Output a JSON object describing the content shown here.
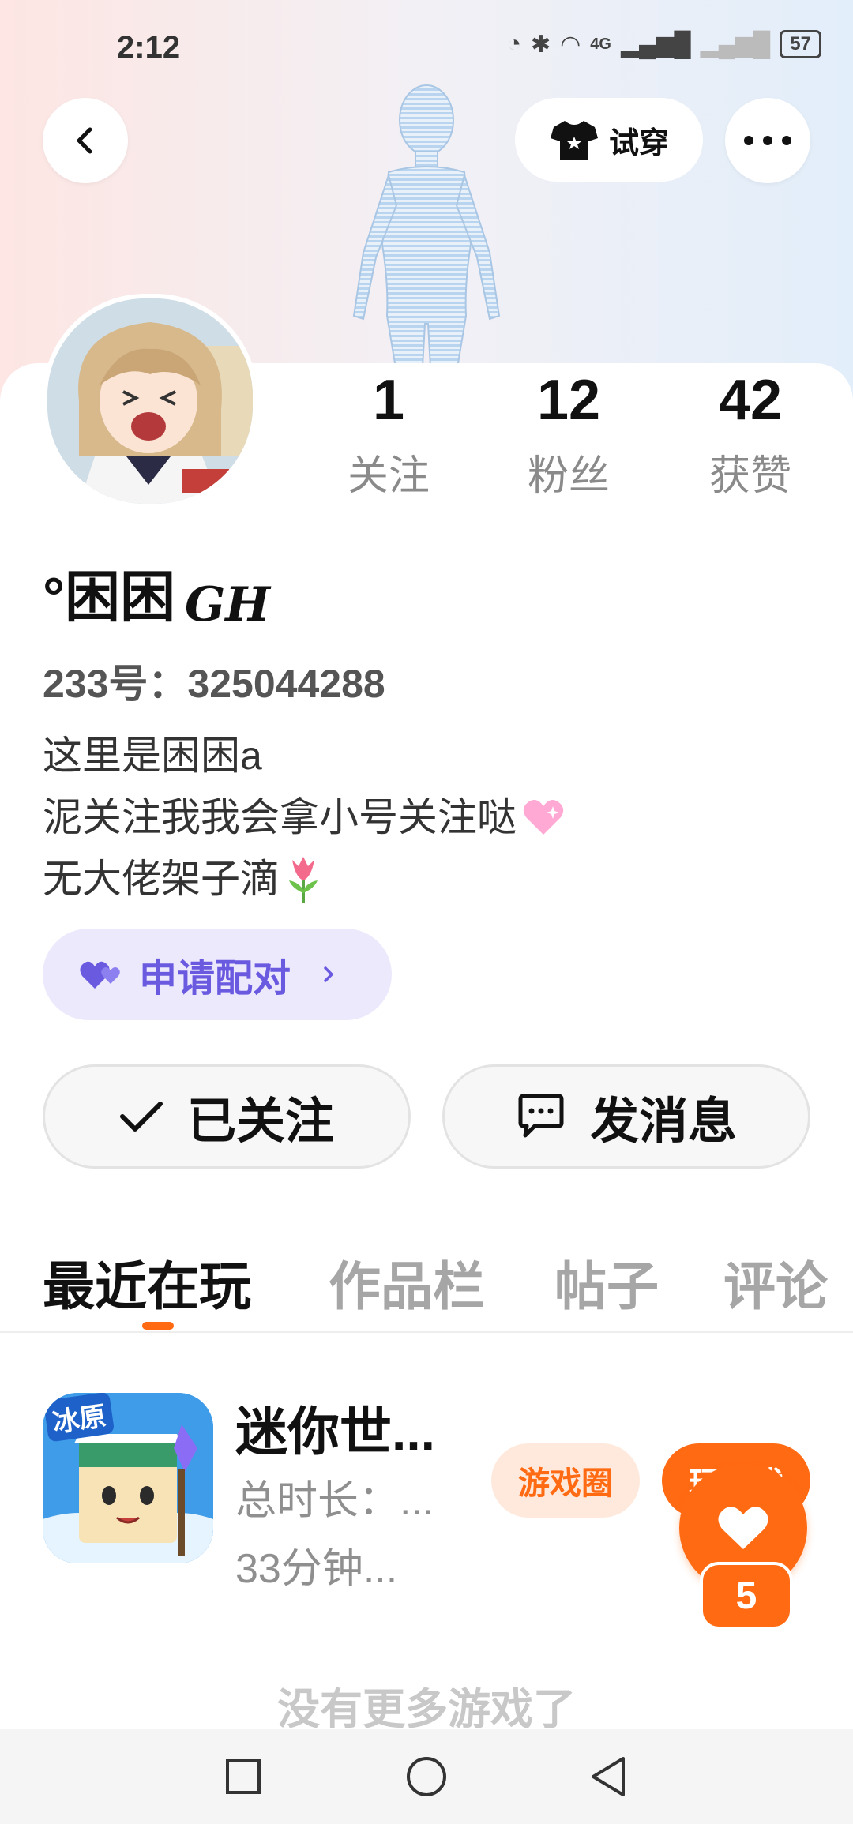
{
  "status_bar": {
    "time": "2:12",
    "network": "4G",
    "battery": "57"
  },
  "header": {
    "try_on_label": "试穿"
  },
  "stats": [
    {
      "value": "1",
      "label": "关注"
    },
    {
      "value": "12",
      "label": "粉丝"
    },
    {
      "value": "42",
      "label": "获赞"
    }
  ],
  "profile": {
    "username": "°困困",
    "username_suffix": "GH",
    "user_id": "233号：325044288",
    "bio": [
      "这里是困困a",
      "泥关注我我会拿小号关注哒",
      "无大佬架子滴"
    ]
  },
  "pair_button": {
    "label": "申请配对"
  },
  "actions": {
    "follow_label": "已关注",
    "message_label": "发消息"
  },
  "tabs": [
    "最近在玩",
    "作品栏",
    "帖子",
    "评论"
  ],
  "active_tab": 0,
  "game": {
    "icon_text": "冰原",
    "name": "迷你世...",
    "total_time": "总时长：...",
    "recent_time": "33分钟...",
    "circle_label": "游戏圈",
    "play_label": "玩游戏"
  },
  "like": {
    "count": "5"
  },
  "footer": {
    "no_more": "没有更多游戏了"
  },
  "colors": {
    "accent": "#ff6a13",
    "pair_purple": "#6a5ae0",
    "pair_bg": "#ece9fc"
  }
}
